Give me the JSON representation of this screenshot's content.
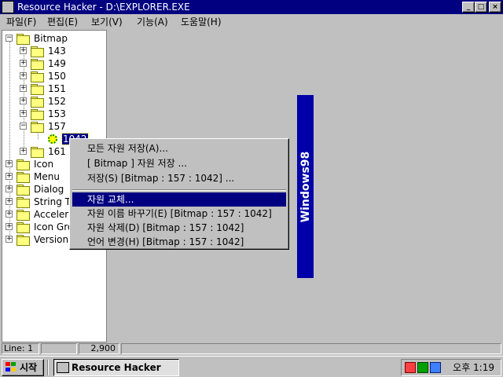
{
  "window": {
    "title": "Resource Hacker  -  D:\\EXPLORER.EXE",
    "minimize": "_",
    "maximize": "□",
    "close": "×"
  },
  "menubar": [
    "파일(F)",
    "편집(E)",
    "보기(V)",
    "기능(A)",
    "도움말(H)"
  ],
  "tree": {
    "root": "Bitmap",
    "bitmaps": [
      "143",
      "149",
      "150",
      "151",
      "152",
      "153",
      "157",
      "161"
    ],
    "selected_leaf": "1042",
    "others": [
      "Icon",
      "Menu",
      "Dialog",
      "String T",
      "Acceleral",
      "Icon Gro",
      "Version"
    ]
  },
  "banner_text": "Windows98",
  "context_menu": {
    "items": [
      "모든 자원 저장(A)...",
      "[ Bitmap ] 자원 저장 ...",
      "저장(S) [Bitmap : 157 : 1042] ...",
      "자원 교체...",
      "자원 이름 바꾸기(E) [Bitmap : 157 : 1042]",
      "자원 삭제(D) [Bitmap : 157 : 1042]",
      "언어 변경(H) [Bitmap : 157 : 1042]"
    ],
    "selected_index": 3
  },
  "statusbar": {
    "line": "Line: 1",
    "size": "2,900"
  },
  "taskbar": {
    "start": "시작",
    "task": "Resource Hacker",
    "clock": "오후 1:19"
  },
  "colors": {
    "titlebar": "#000080",
    "selection": "#000080",
    "banner": "#0000a8",
    "face": "#c0c0c0"
  }
}
